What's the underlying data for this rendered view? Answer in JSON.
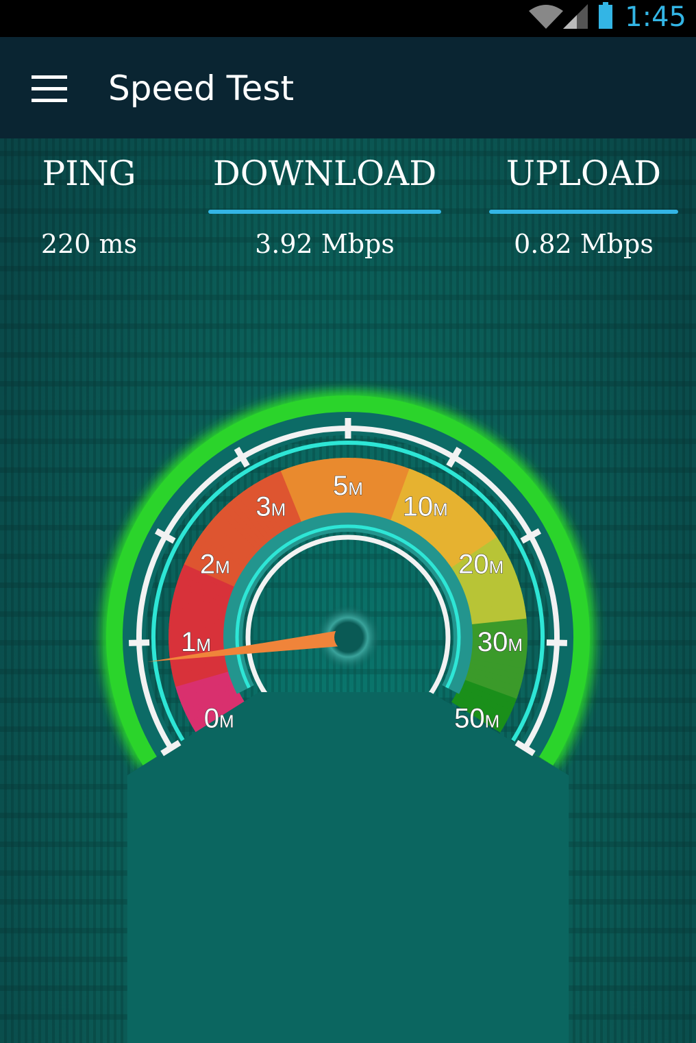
{
  "status_bar": {
    "time": "1:45",
    "icons": [
      "wifi-icon",
      "signal-icon",
      "battery-icon"
    ],
    "accent": "#33b5e5"
  },
  "app_bar": {
    "title": "Speed Test",
    "menu_icon": "hamburger-menu-icon"
  },
  "stats": [
    {
      "label": "PING",
      "value": "220 ms",
      "underlined": false
    },
    {
      "label": "DOWNLOAD",
      "value": "3.92 Mbps",
      "underlined": true
    },
    {
      "label": "UPLOAD",
      "value": "0.82 Mbps",
      "underlined": true
    }
  ],
  "gauge": {
    "scale_labels": [
      {
        "num": "0",
        "unit": "M"
      },
      {
        "num": "1",
        "unit": "M"
      },
      {
        "num": "2",
        "unit": "M"
      },
      {
        "num": "3",
        "unit": "M"
      },
      {
        "num": "5",
        "unit": "M"
      },
      {
        "num": "10",
        "unit": "M"
      },
      {
        "num": "20",
        "unit": "M"
      },
      {
        "num": "30",
        "unit": "M"
      },
      {
        "num": "50",
        "unit": "M"
      }
    ],
    "needle_value_mbps": 0.82,
    "colors": {
      "glow": "#2bd42b",
      "ring": "#2ee6d6",
      "needle": "#f0843a",
      "band_low": "#d9306e",
      "band_mid": "#e98a2e",
      "band_high": "#1a8f1a"
    }
  }
}
